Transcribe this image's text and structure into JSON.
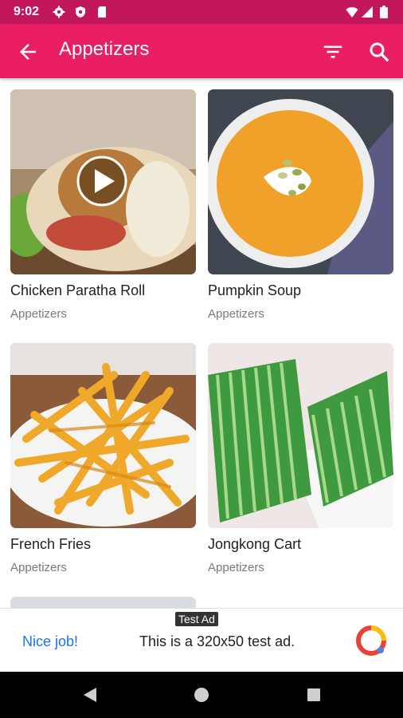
{
  "status_bar": {
    "time": "9:02"
  },
  "app_bar": {
    "title": "Appetizers"
  },
  "recipes": [
    {
      "name": "Chicken Paratha Roll",
      "category": "Appetizers"
    },
    {
      "name": "Pumpkin Soup",
      "category": "Appetizers"
    },
    {
      "name": "French Fries",
      "category": "Appetizers"
    },
    {
      "name": "Jongkong Cart",
      "category": "Appetizers"
    }
  ],
  "ad": {
    "tag": "Test Ad",
    "cta": "Nice job!",
    "message": "This is a 320x50 test ad."
  },
  "colors": {
    "status_bar": "#c2185b",
    "app_bar": "#e91e63",
    "ad_link": "#1a73e8"
  },
  "icons": [
    "settings-icon",
    "shield-icon",
    "sd-card-icon",
    "wifi-icon",
    "signal-icon",
    "battery-icon",
    "back-arrow-icon",
    "filter-icon",
    "search-icon",
    "play-icon",
    "ad-logo-icon",
    "nav-back-icon",
    "nav-home-icon",
    "nav-recents-icon"
  ]
}
